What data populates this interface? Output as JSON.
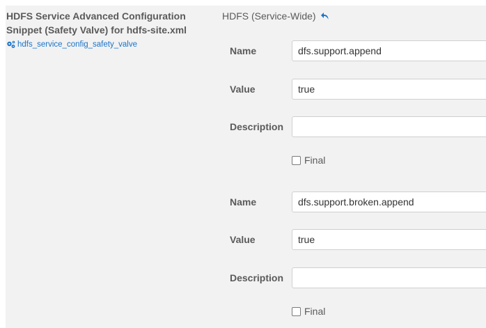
{
  "property": {
    "title": "HDFS Service Advanced Configuration Snippet (Safety Valve) for hdfs-site.xml",
    "key": "hdfs_service_config_safety_valve",
    "key_icon": "gears-icon"
  },
  "scope": {
    "label": "HDFS (Service-Wide)",
    "undo_icon": "undo-icon"
  },
  "labels": {
    "name": "Name",
    "value": "Value",
    "description": "Description",
    "final": "Final"
  },
  "entries": [
    {
      "name": "dfs.support.append",
      "value": "true",
      "description": "",
      "final": false
    },
    {
      "name": "dfs.support.broken.append",
      "value": "true",
      "description": "",
      "final": false
    }
  ],
  "colors": {
    "panel_bg": "#f2f2f2",
    "link": "#1a73c7",
    "label_text": "#5a5a5a"
  }
}
